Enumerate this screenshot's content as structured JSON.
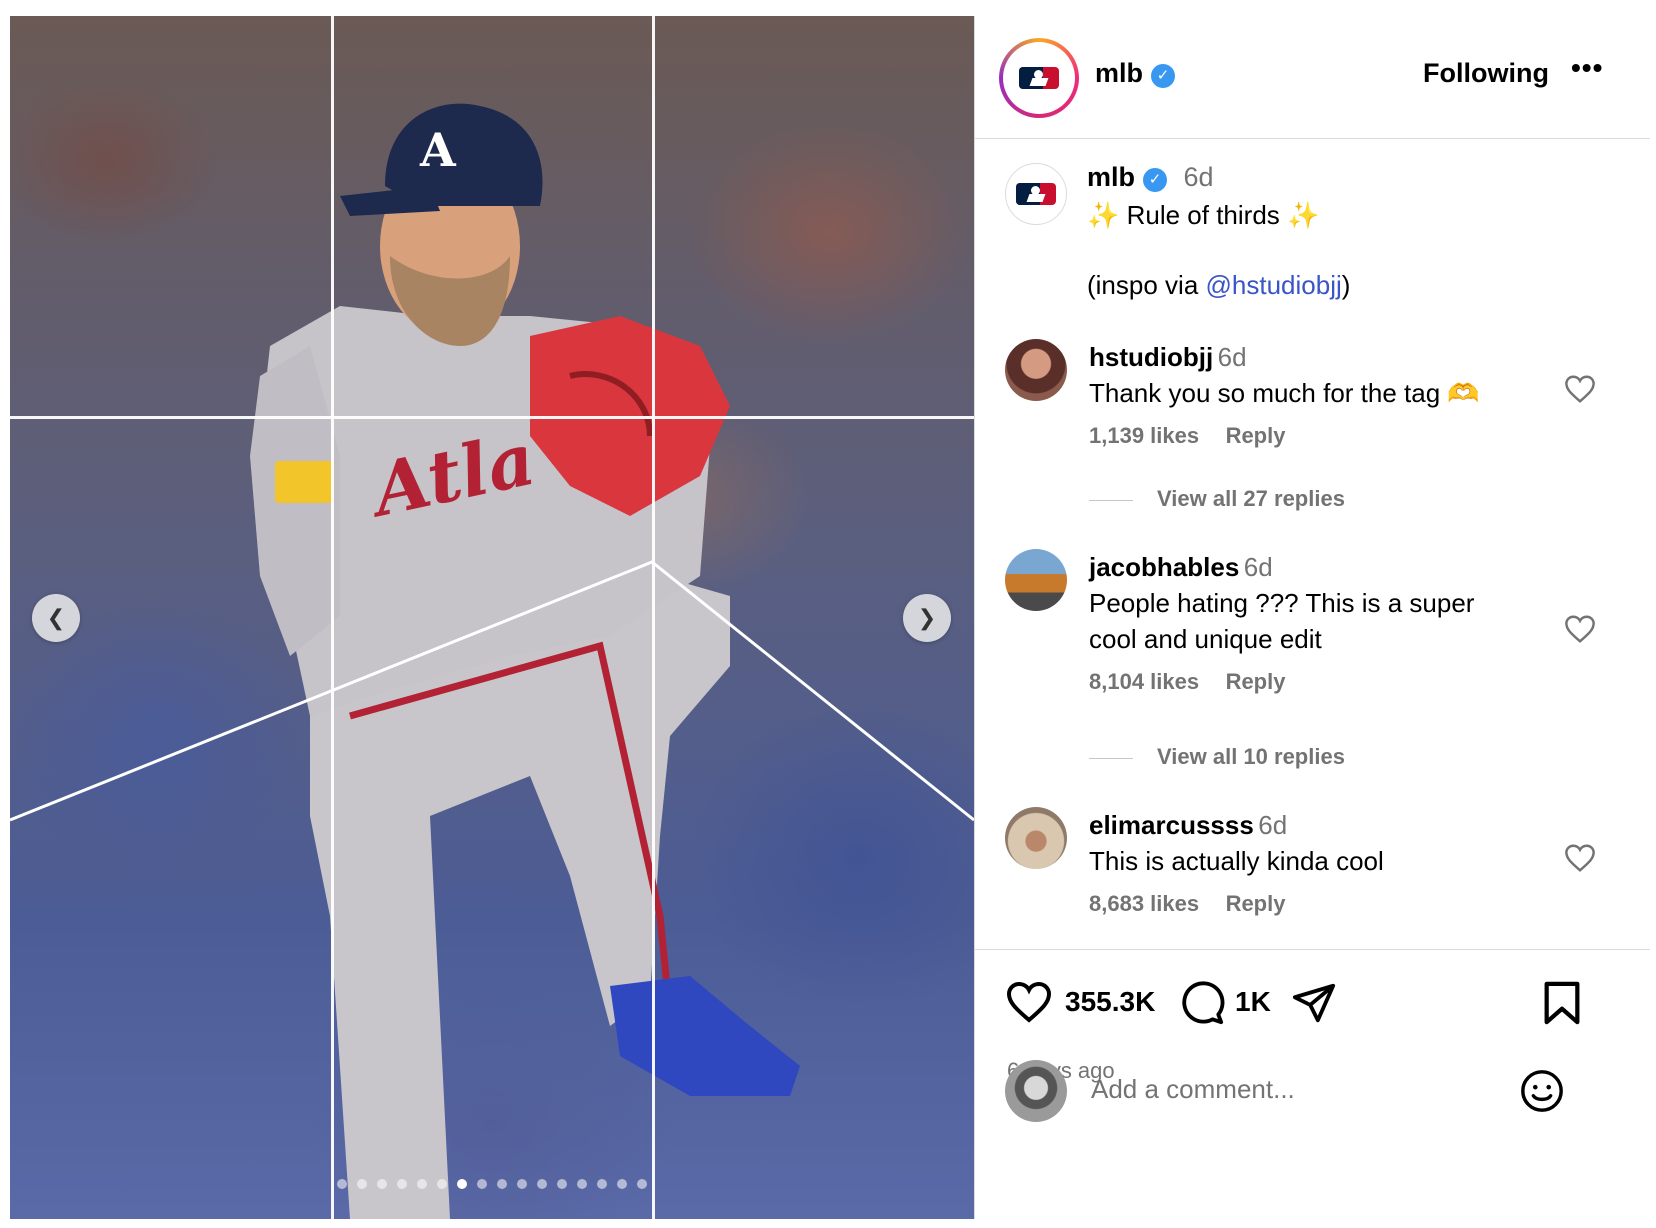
{
  "post": {
    "account": "mlb",
    "follow_label": "Following",
    "more_label": "•••",
    "caption_time": "6d",
    "caption_line1_pre": "✨",
    "caption_line1": " Rule of thirds ",
    "caption_line1_post": "✨",
    "caption_line2_pre": "(inspo via ",
    "caption_mention": "@hstudiobjj",
    "caption_line2_post": ")"
  },
  "comments": [
    {
      "user": "hstudiobjj",
      "time": "6d",
      "text": "Thank you so much for the tag 🫶",
      "likes": "1,139 likes",
      "reply": "Reply",
      "view_replies": "View all 27 replies"
    },
    {
      "user": "jacobhables",
      "time": "6d",
      "text_line1": "People hating ??? This is a super",
      "text_line2": "cool and unique edit",
      "likes": "8,104 likes",
      "reply": "Reply",
      "view_replies": "View all 10 replies"
    },
    {
      "user": "elimarcussss",
      "time": "6d",
      "text": "This is actually kinda cool",
      "likes": "8,683 likes",
      "reply": "Reply"
    }
  ],
  "actions": {
    "like_count": "355.3K",
    "comment_count": "1K",
    "posted_ago": "6 days ago"
  },
  "add_comment": {
    "placeholder": "Add a comment..."
  },
  "carousel": {
    "prev_icon": "chevron-left-icon",
    "next_icon": "chevron-right-icon",
    "dot_count": 16,
    "active_index": 6
  },
  "colors": {
    "verified": "#3897f0",
    "mention": "#3a55c8",
    "muted": "#737373",
    "border": "#dbdbdb"
  }
}
